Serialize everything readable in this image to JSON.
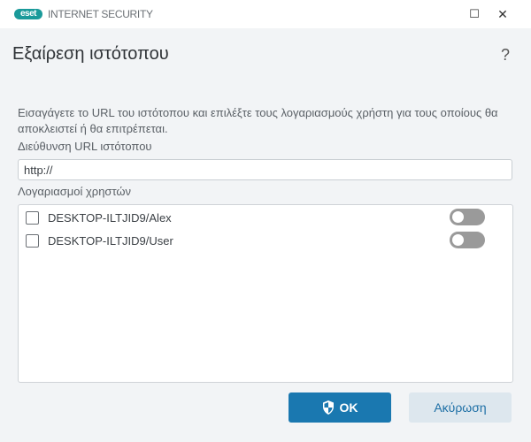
{
  "app": {
    "logo_text": "eset",
    "product": "INTERNET SECURITY",
    "minimize": "☐",
    "close": "✕"
  },
  "dialog": {
    "title": "Εξαίρεση ιστότοπου",
    "help": "?",
    "description": "Εισαγάγετε το URL του ιστότοπου και επιλέξτε τους λογαριασμούς χρήστη για τους οποίους θα αποκλειστεί ή θα επιτρέπεται.",
    "url_label": "Διεύθυνση URL ιστότοπου",
    "url_value": "http://",
    "accounts_label": "Λογαριασμοί χρηστών",
    "accounts": [
      {
        "name": "DESKTOP-ILTJID9/Alex",
        "checked": false,
        "toggle_on": false
      },
      {
        "name": "DESKTOP-ILTJID9/User",
        "checked": false,
        "toggle_on": false
      }
    ],
    "ok_label": "OK",
    "cancel_label": "Ακύρωση"
  },
  "colors": {
    "accent": "#1a78b0",
    "brand": "#1a9a9a"
  }
}
